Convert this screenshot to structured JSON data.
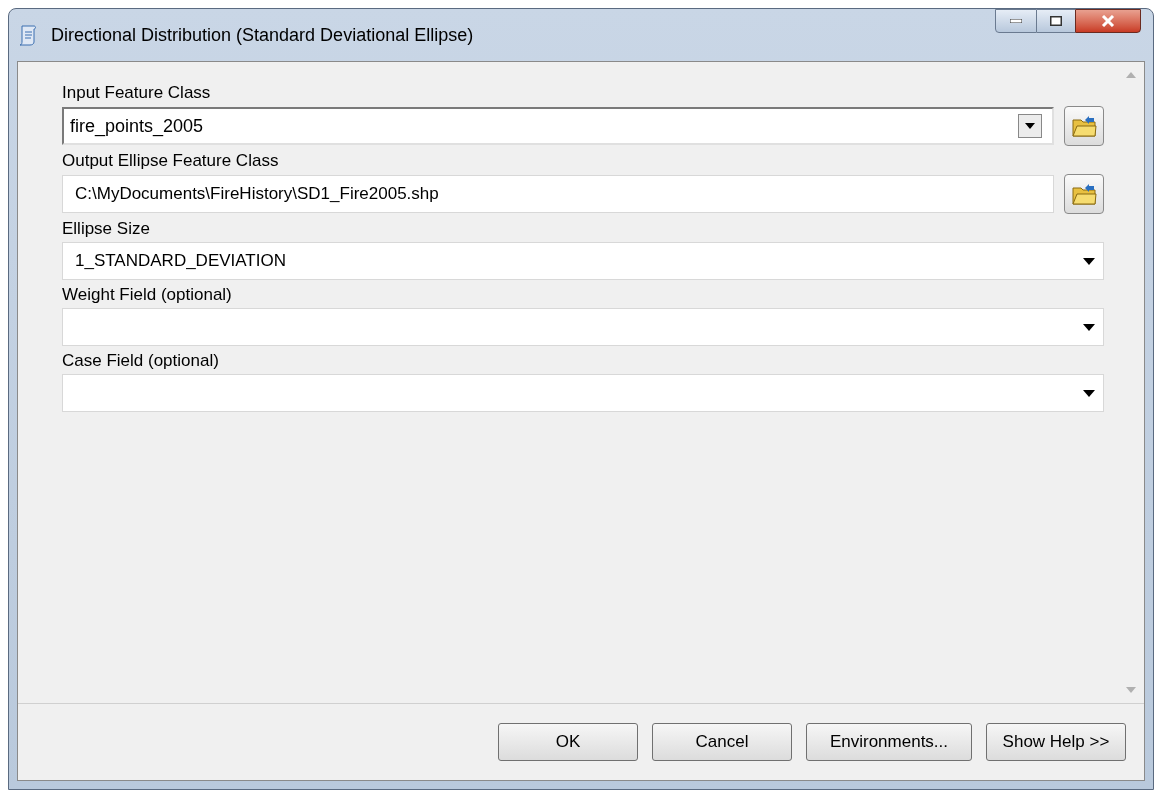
{
  "window": {
    "title": "Directional Distribution (Standard Deviational Ellipse)"
  },
  "parameters": [
    {
      "kind": "combo",
      "label": "Input Feature Class",
      "value": "fire_points_2005",
      "browse": true
    },
    {
      "kind": "text",
      "label": "Output Ellipse Feature Class",
      "value": "C:\\MyDocuments\\FireHistory\\SD1_Fire2005.shp",
      "browse": true
    },
    {
      "kind": "dropdown",
      "label": "Ellipse Size",
      "value": "1_STANDARD_DEVIATION",
      "browse": false
    },
    {
      "kind": "dropdown",
      "label": "Weight Field (optional)",
      "browse": false
    },
    {
      "kind": "dropdown",
      "label": "Case Field (optional)",
      "browse": false
    }
  ],
  "buttons": [
    "OK",
    "Cancel",
    "Environments...",
    "Show Help >>"
  ]
}
